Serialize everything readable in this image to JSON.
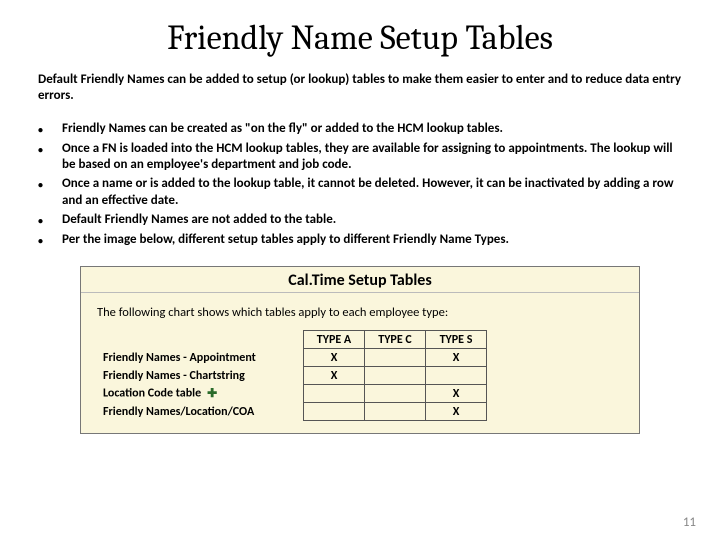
{
  "title": "Friendly Name Setup Tables",
  "intro": "Default Friendly Names can be added to setup (or lookup) tables to make them easier to enter and to reduce data entry errors.",
  "bullets": [
    "Friendly Names can be created as \"on the fly\" or added to the HCM lookup tables.",
    "Once a FN is loaded into the HCM lookup tables, they are available for assigning to appointments.  The lookup will be based on an employee's department and job code.",
    "Once a name or is added to the lookup table, it cannot be deleted.  However, it can be inactivated by adding a row and an effective date.",
    "Default Friendly Names are not added to the table.",
    "Per the image below, different setup tables apply to different Friendly Name Types."
  ],
  "panel": {
    "title": "Cal.Time Setup Tables",
    "desc": "The following chart shows which tables apply to each employee type:"
  },
  "chart_data": {
    "type": "table",
    "columns": [
      "TYPE A",
      "TYPE C",
      "TYPE S"
    ],
    "rows": [
      {
        "label": "Friendly Names - Appointment",
        "values": [
          "X",
          "",
          "X"
        ]
      },
      {
        "label": "Friendly Names - Chartstring",
        "values": [
          "X",
          "",
          ""
        ]
      },
      {
        "label": "Location Code table",
        "values": [
          "",
          "",
          "X"
        ],
        "icon": "plus"
      },
      {
        "label": "Friendly Names/Location/COA",
        "values": [
          "",
          "",
          "X"
        ]
      }
    ]
  },
  "page_number": "11"
}
